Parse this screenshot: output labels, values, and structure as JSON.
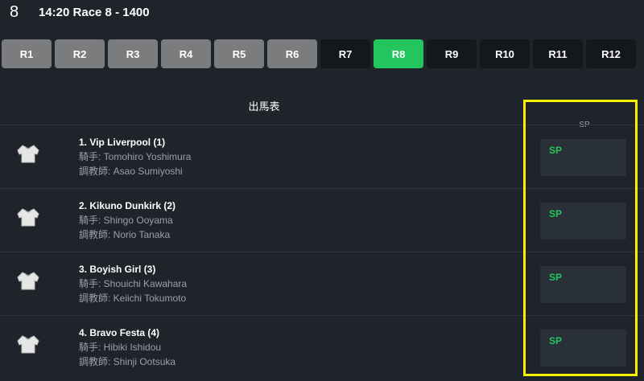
{
  "header": {
    "race_number": "8",
    "title": "14:20  Race 8 - 1400"
  },
  "race_tabs": [
    {
      "label": "R1",
      "state": "past"
    },
    {
      "label": "R2",
      "state": "past"
    },
    {
      "label": "R3",
      "state": "past"
    },
    {
      "label": "R4",
      "state": "past"
    },
    {
      "label": "R5",
      "state": "past"
    },
    {
      "label": "R6",
      "state": "past"
    },
    {
      "label": "R7",
      "state": "future"
    },
    {
      "label": "R8",
      "state": "active"
    },
    {
      "label": "R9",
      "state": "future"
    },
    {
      "label": "R10",
      "state": "future"
    },
    {
      "label": "R11",
      "state": "future"
    },
    {
      "label": "R12",
      "state": "future"
    }
  ],
  "table": {
    "title": "出馬表",
    "sp_header": "SP"
  },
  "runners": [
    {
      "name": "1. Vip Liverpool (1)",
      "jockey": "騎手: Tomohiro Yoshimura",
      "trainer": "調教師: Asao Sumiyoshi",
      "sp": "SP"
    },
    {
      "name": "2. Kikuno Dunkirk (2)",
      "jockey": "騎手: Shingo Ooyama",
      "trainer": "調教師: Norio Tanaka",
      "sp": "SP"
    },
    {
      "name": "3. Boyish Girl (3)",
      "jockey": "騎手: Shouichi Kawahara",
      "trainer": "調教師: Keiichi Tokumoto",
      "sp": "SP"
    },
    {
      "name": "4. Bravo Festa (4)",
      "jockey": "騎手: Hibiki Ishidou",
      "trainer": "調教師: Shinji Ootsuka",
      "sp": "SP"
    }
  ],
  "colors": {
    "background": "#1f242b",
    "active_tab": "#22c55e",
    "past_tab": "#7a7c7e",
    "future_tab": "#14181d",
    "sp_text": "#22c55e",
    "highlight": "#f5f000"
  },
  "icons": {
    "silk": "jockey-silk-icon"
  }
}
